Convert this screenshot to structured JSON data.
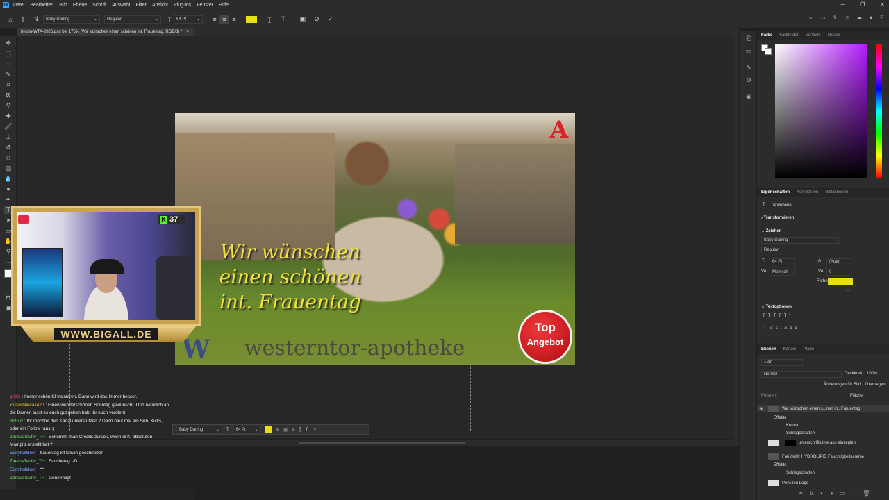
{
  "menu": [
    "Datei",
    "Bearbeiten",
    "Bild",
    "Ebene",
    "Schrift",
    "Auswahl",
    "Filter",
    "Ansicht",
    "Plug-ins",
    "Fenster",
    "Hilfe"
  ],
  "app_logo": "Ps",
  "options": {
    "font_family": "Baby Darling",
    "font_style": "Regular",
    "font_size": "64 Pt",
    "text_color": "#e6df14"
  },
  "document": {
    "tab_title": "Imidin-WTA-2026.psd bei 175% (Wir wünschen einen schönen int. Frauentag, RGB/8) *"
  },
  "artwork": {
    "headline": [
      "Wir wünschen",
      "einen schönen",
      "int. Frauentag"
    ],
    "watermark": "westerntor-apotheke",
    "w_logo": "W",
    "apotheke_logo": "A",
    "badge_line1": "Top",
    "badge_line2": "Angebot"
  },
  "stream": {
    "viewer_count": "37",
    "kick_label": "K",
    "banner": "WWW.BIGALL.DE"
  },
  "chat": [
    {
      "user": "gnlife",
      "color": "#e04a6a",
      "text": "Immer schön KI trainieren. Dann wird das Immer besser."
    },
    {
      "user": "xxlavidalocax420",
      "color": "#e6b940",
      "text": "Einen wunderschönen Sonntag gewünscht. Und natürlich an die Damen lasst es euch gut gehen habt ihr euch verdient"
    },
    {
      "user": "BotRix",
      "color": "#6ee06e",
      "text": "Ihr möchtet den Kanal unterstützen ? Dann haut mal ein Sub, Kicks, oder ein Follow raus :)"
    },
    {
      "user": "ZaerusTeufer_TH",
      "color": "#6ee06e",
      "text": "Bekommt man Credits zurück, wenn di KI absoluten Mumpitz erstellt hat ?"
    },
    {
      "user": "Eddybulldoor",
      "color": "#7aa9ff",
      "text": "frauentag ist falsch geschrieben"
    },
    {
      "user": "ZaerusTeufer_TH",
      "color": "#6ee06e",
      "text": "Fauchetag :-D"
    },
    {
      "user": "Eddybulldoor",
      "color": "#7aa9ff",
      "text": "^^"
    },
    {
      "user": "ZaerusTeufer_TH",
      "color": "#6ee06e",
      "text": "Genehmigt"
    }
  ],
  "floating_toolbar": {
    "font": "Baby Darling",
    "size": "64 Pt"
  },
  "panels": {
    "color_tabs": [
      "Farbe",
      "Farbfelder",
      "Verläufe",
      "Muster"
    ],
    "props_tabs": [
      "Eigenschaften",
      "Korrekturen",
      "Bibliotheken"
    ],
    "layer_type": "Textebene",
    "transform": "Transformieren",
    "char_title": "Zeichen",
    "char_font": "Baby Darling",
    "char_style": "Regular",
    "char_size": "64 Pt",
    "char_leading": "(Auto)",
    "char_kerning": "Metrisch",
    "char_tracking": "0",
    "char_color_label": "Farbe:",
    "textopt": "Textoptionen",
    "layers_tabs": [
      "Ebenen",
      "Kanäle",
      "Pfade"
    ],
    "layer_search": "Art",
    "blend_mode": "Normal",
    "opacity_label": "Deckkraft:",
    "opacity": "100%",
    "fill_label": "Fläche:",
    "propagate": "Änderungen für Bild 1 übertragen",
    "lock_label": "Fixieren:",
    "layers": [
      {
        "name": "Wir wünschen einen s...nen int. Frauentag",
        "indent": 0,
        "kind": "text"
      },
      {
        "name": "Effekte",
        "indent": 1,
        "kind": "fx"
      },
      {
        "name": "Kontur",
        "indent": 2,
        "kind": "fx"
      },
      {
        "name": "Schlagschatten",
        "indent": 2,
        "kind": "fx"
      },
      {
        "name": "unterschriftslinie aus einzeplen",
        "indent": 0,
        "kind": "image"
      },
      {
        "name": "Frei ök@: HYDROLIPID Feuchtigkeitscreme",
        "indent": 0,
        "kind": "text"
      },
      {
        "name": "Effekte",
        "indent": 1,
        "kind": "fx"
      },
      {
        "name": "Schlagschatten",
        "indent": 2,
        "kind": "fx"
      },
      {
        "name": "Pensilen Logo",
        "indent": 0,
        "kind": "image"
      }
    ]
  }
}
